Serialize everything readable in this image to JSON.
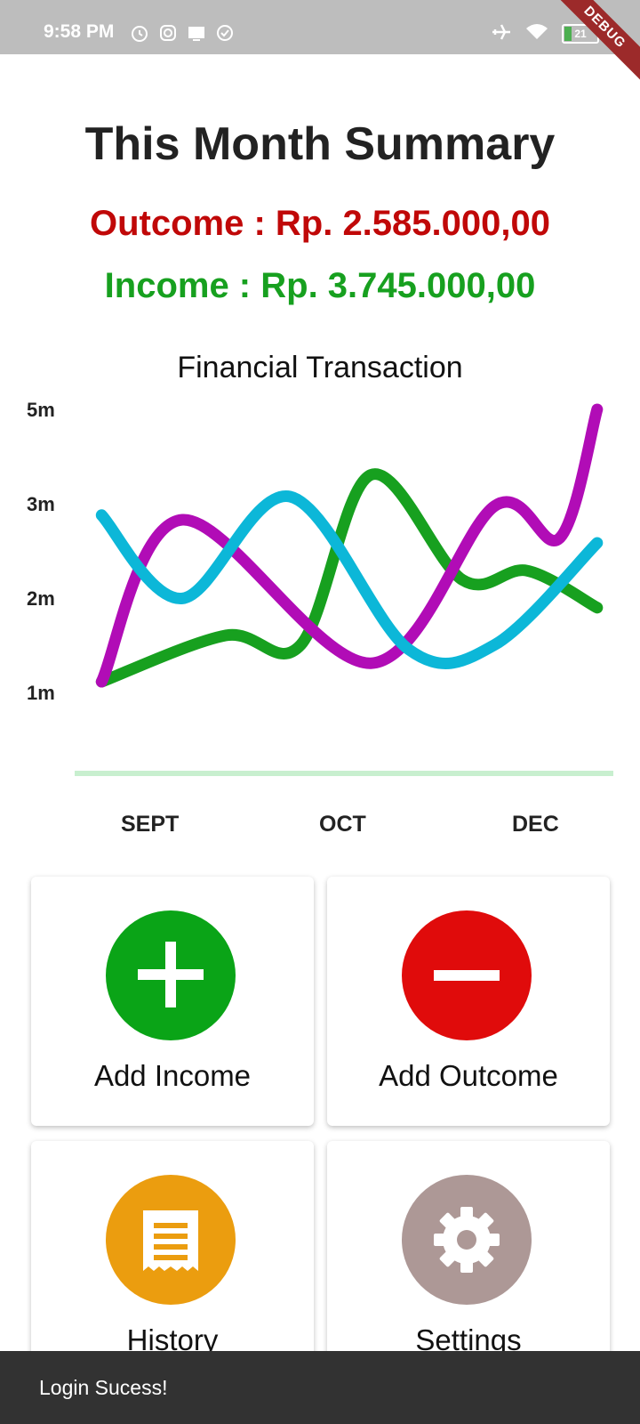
{
  "status_bar": {
    "time": "9:58 PM",
    "battery": "21",
    "debug_label": "DEBUG"
  },
  "summary": {
    "title": "This Month Summary",
    "outcome": "Outcome : Rp. 2.585.000,00",
    "income": "Income : Rp. 3.745.000,00",
    "outcome_color": "#c00808",
    "income_color": "#17a01f"
  },
  "chart_data": {
    "type": "line",
    "title": "Financial Transaction",
    "ytick_labels": [
      "5m",
      "3m",
      "2m",
      "1m"
    ],
    "xtick_labels": [
      "SEPT",
      "OCT",
      "DEC"
    ],
    "series": [
      {
        "color": "#17a01f",
        "points": [
          [
            0.05,
            1.0
          ],
          [
            0.28,
            1.5
          ],
          [
            0.42,
            1.4
          ],
          [
            0.55,
            3.5
          ],
          [
            0.72,
            2.1
          ],
          [
            0.84,
            2.2
          ],
          [
            0.97,
            1.8
          ]
        ]
      },
      {
        "color": "#b10cb6",
        "points": [
          [
            0.05,
            1.0
          ],
          [
            0.2,
            2.75
          ],
          [
            0.55,
            1.2
          ],
          [
            0.78,
            2.9
          ],
          [
            0.9,
            2.55
          ],
          [
            0.97,
            5.0
          ]
        ]
      },
      {
        "color": "#0cb7d8",
        "points": [
          [
            0.05,
            2.8
          ],
          [
            0.2,
            1.9
          ],
          [
            0.4,
            3.0
          ],
          [
            0.62,
            1.35
          ],
          [
            0.78,
            1.4
          ],
          [
            0.97,
            2.5
          ]
        ]
      }
    ]
  },
  "actions": [
    {
      "label": "Add Income",
      "color": "#0aa417",
      "icon": "plus-icon"
    },
    {
      "label": "Add Outcome",
      "color": "#e00b0b",
      "icon": "minus-icon"
    },
    {
      "label": "History",
      "color": "#eb9d0f",
      "icon": "receipt-icon"
    },
    {
      "label": "Settings",
      "color": "#ad9896",
      "icon": "gear-icon"
    }
  ],
  "snackbar": {
    "message": "Login Sucess!"
  }
}
